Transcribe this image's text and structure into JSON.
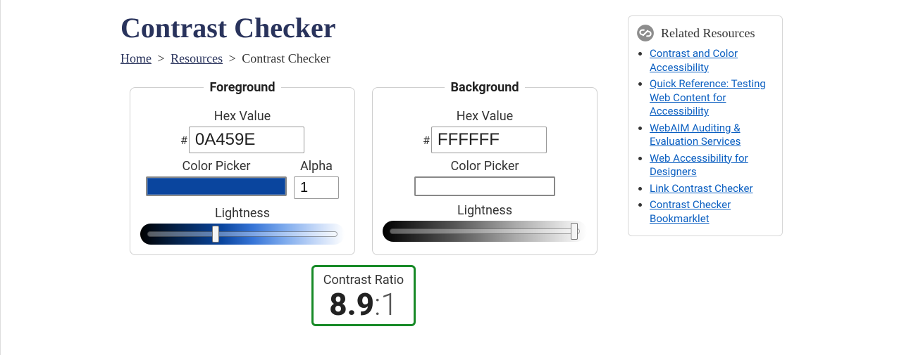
{
  "title": "Contrast Checker",
  "breadcrumb": {
    "home": "Home",
    "resources": "Resources",
    "sep": ">",
    "current": "Contrast Checker"
  },
  "foreground": {
    "legend": "Foreground",
    "hex_label": "Hex Value",
    "hash": "#",
    "hex_value": "0A459E",
    "picker_label": "Color Picker",
    "alpha_label": "Alpha",
    "alpha_value": "1",
    "lightness_label": "Lightness",
    "swatch_color": "#0A459E",
    "lightness_percent": 36
  },
  "background": {
    "legend": "Background",
    "hex_label": "Hex Value",
    "hash": "#",
    "hex_value": "FFFFFF",
    "picker_label": "Color Picker",
    "lightness_label": "Lightness",
    "swatch_color": "#FFFFFF",
    "lightness_percent": 97
  },
  "ratio": {
    "label": "Contrast Ratio",
    "value": "8.9",
    "suffix": ":1"
  },
  "related": {
    "header": "Related Resources",
    "items": [
      "Contrast and Color Accessibility",
      "Quick Reference: Testing Web Content for Accessibility",
      "WebAIM Auditing & Evaluation Services",
      "Web Accessibility for Designers",
      "Link Contrast Checker",
      "Contrast Checker Bookmarklet"
    ]
  }
}
